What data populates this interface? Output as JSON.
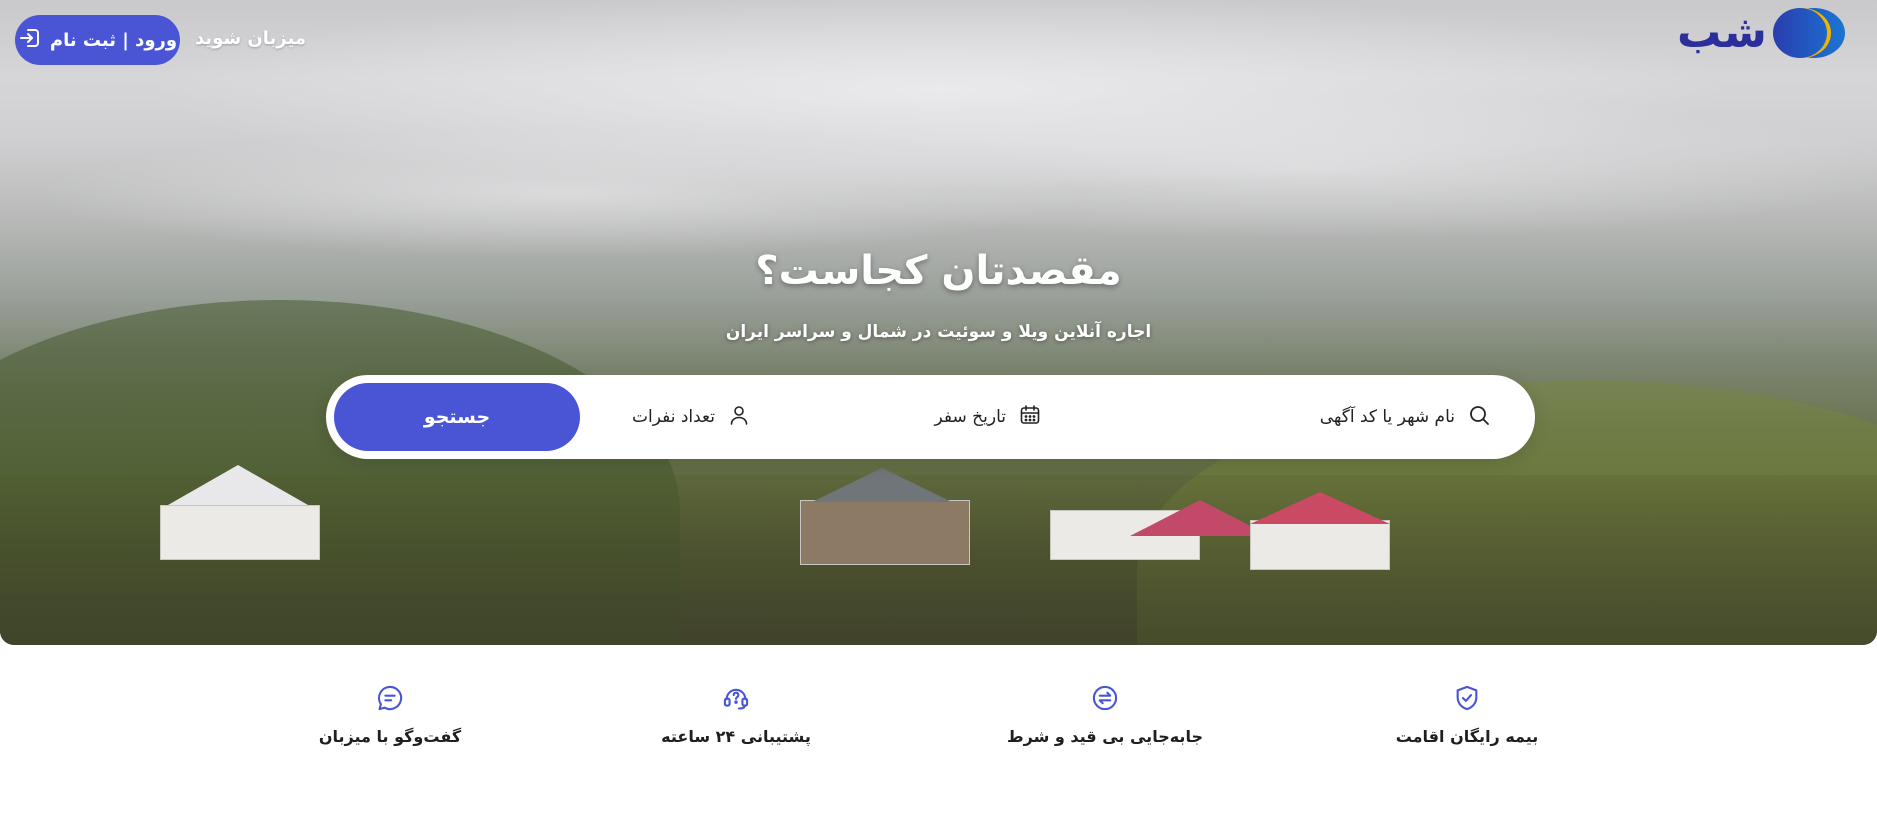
{
  "header": {
    "logo_text": "شب",
    "login_label": "ورود | ثبت نام",
    "host_label": "میزبان شوید"
  },
  "hero": {
    "title": "مقصدتان کجاست؟",
    "subtitle": "اجاره آنلاین ویلا و سوئیت در شمال و سراسر ایران"
  },
  "search": {
    "city_placeholder": "نام شهر یا کد آگهی",
    "date_label": "تاریخ سفر",
    "guests_label": "تعداد نفرات",
    "button_label": "جستجو"
  },
  "features": [
    {
      "label": "بیمه رایگان اقامت",
      "icon": "shield-check-icon"
    },
    {
      "label": "جابه‌جایی بی قید و شرط",
      "icon": "swap-icon"
    },
    {
      "label": "پشتیبانی ۲۴ ساعته",
      "icon": "headset-icon"
    },
    {
      "label": "گفت‌وگو با میزبان",
      "icon": "chat-icon"
    }
  ],
  "colors": {
    "accent": "#4a55d6",
    "logo_text": "#2a2f9b",
    "logo_moon": "#f2b400"
  }
}
